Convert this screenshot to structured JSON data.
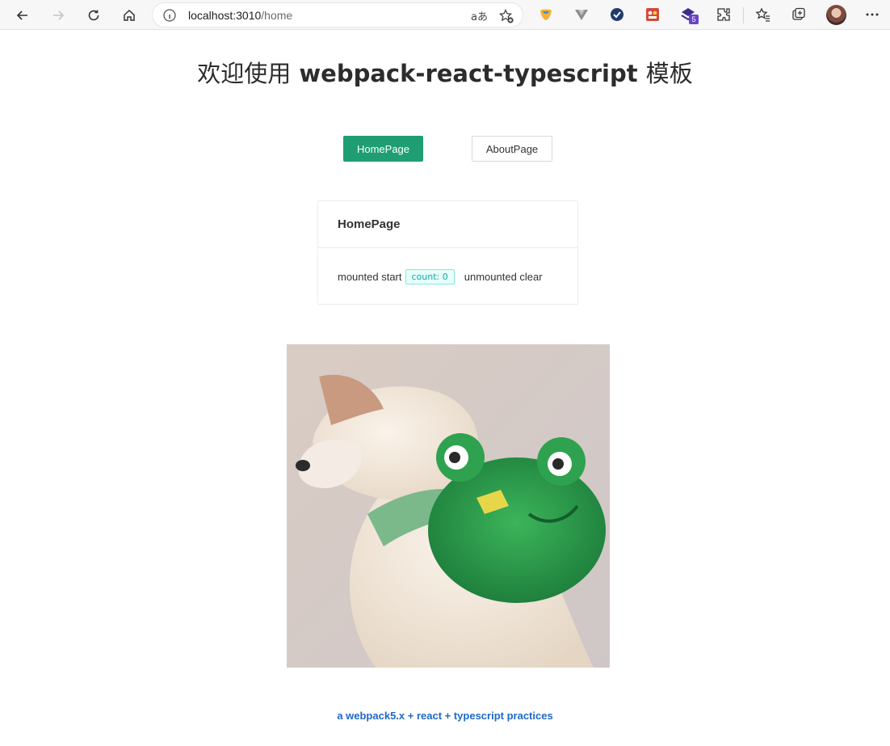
{
  "browser": {
    "url_host": "localhost:3010",
    "url_path": "/home",
    "read_aloud_glyph": "aあ",
    "extensions": [
      "brand-extension-icon",
      "vue-devtools-icon",
      "check-circle-icon",
      "puzzle-game-icon",
      "layers-extension-icon",
      "extensions-icon"
    ],
    "extension_badge": "5"
  },
  "page": {
    "title_cn_1": "欢迎使用",
    "title_en": "webpack-react-typescript",
    "title_cn_2": "模板"
  },
  "nav": {
    "home_label": "HomePage",
    "about_label": "AboutPage",
    "active_color": "#1e9e72"
  },
  "card": {
    "title": "HomePage",
    "mounted_text": "mounted start",
    "count_tag": "count: 0",
    "unmounted_text": "unmounted clear"
  },
  "image": {
    "subject": "white dog wearing green frog backpack"
  },
  "footer": {
    "link_text": "a webpack5.x + react + typescript practices",
    "link_color": "#1f69c7"
  }
}
